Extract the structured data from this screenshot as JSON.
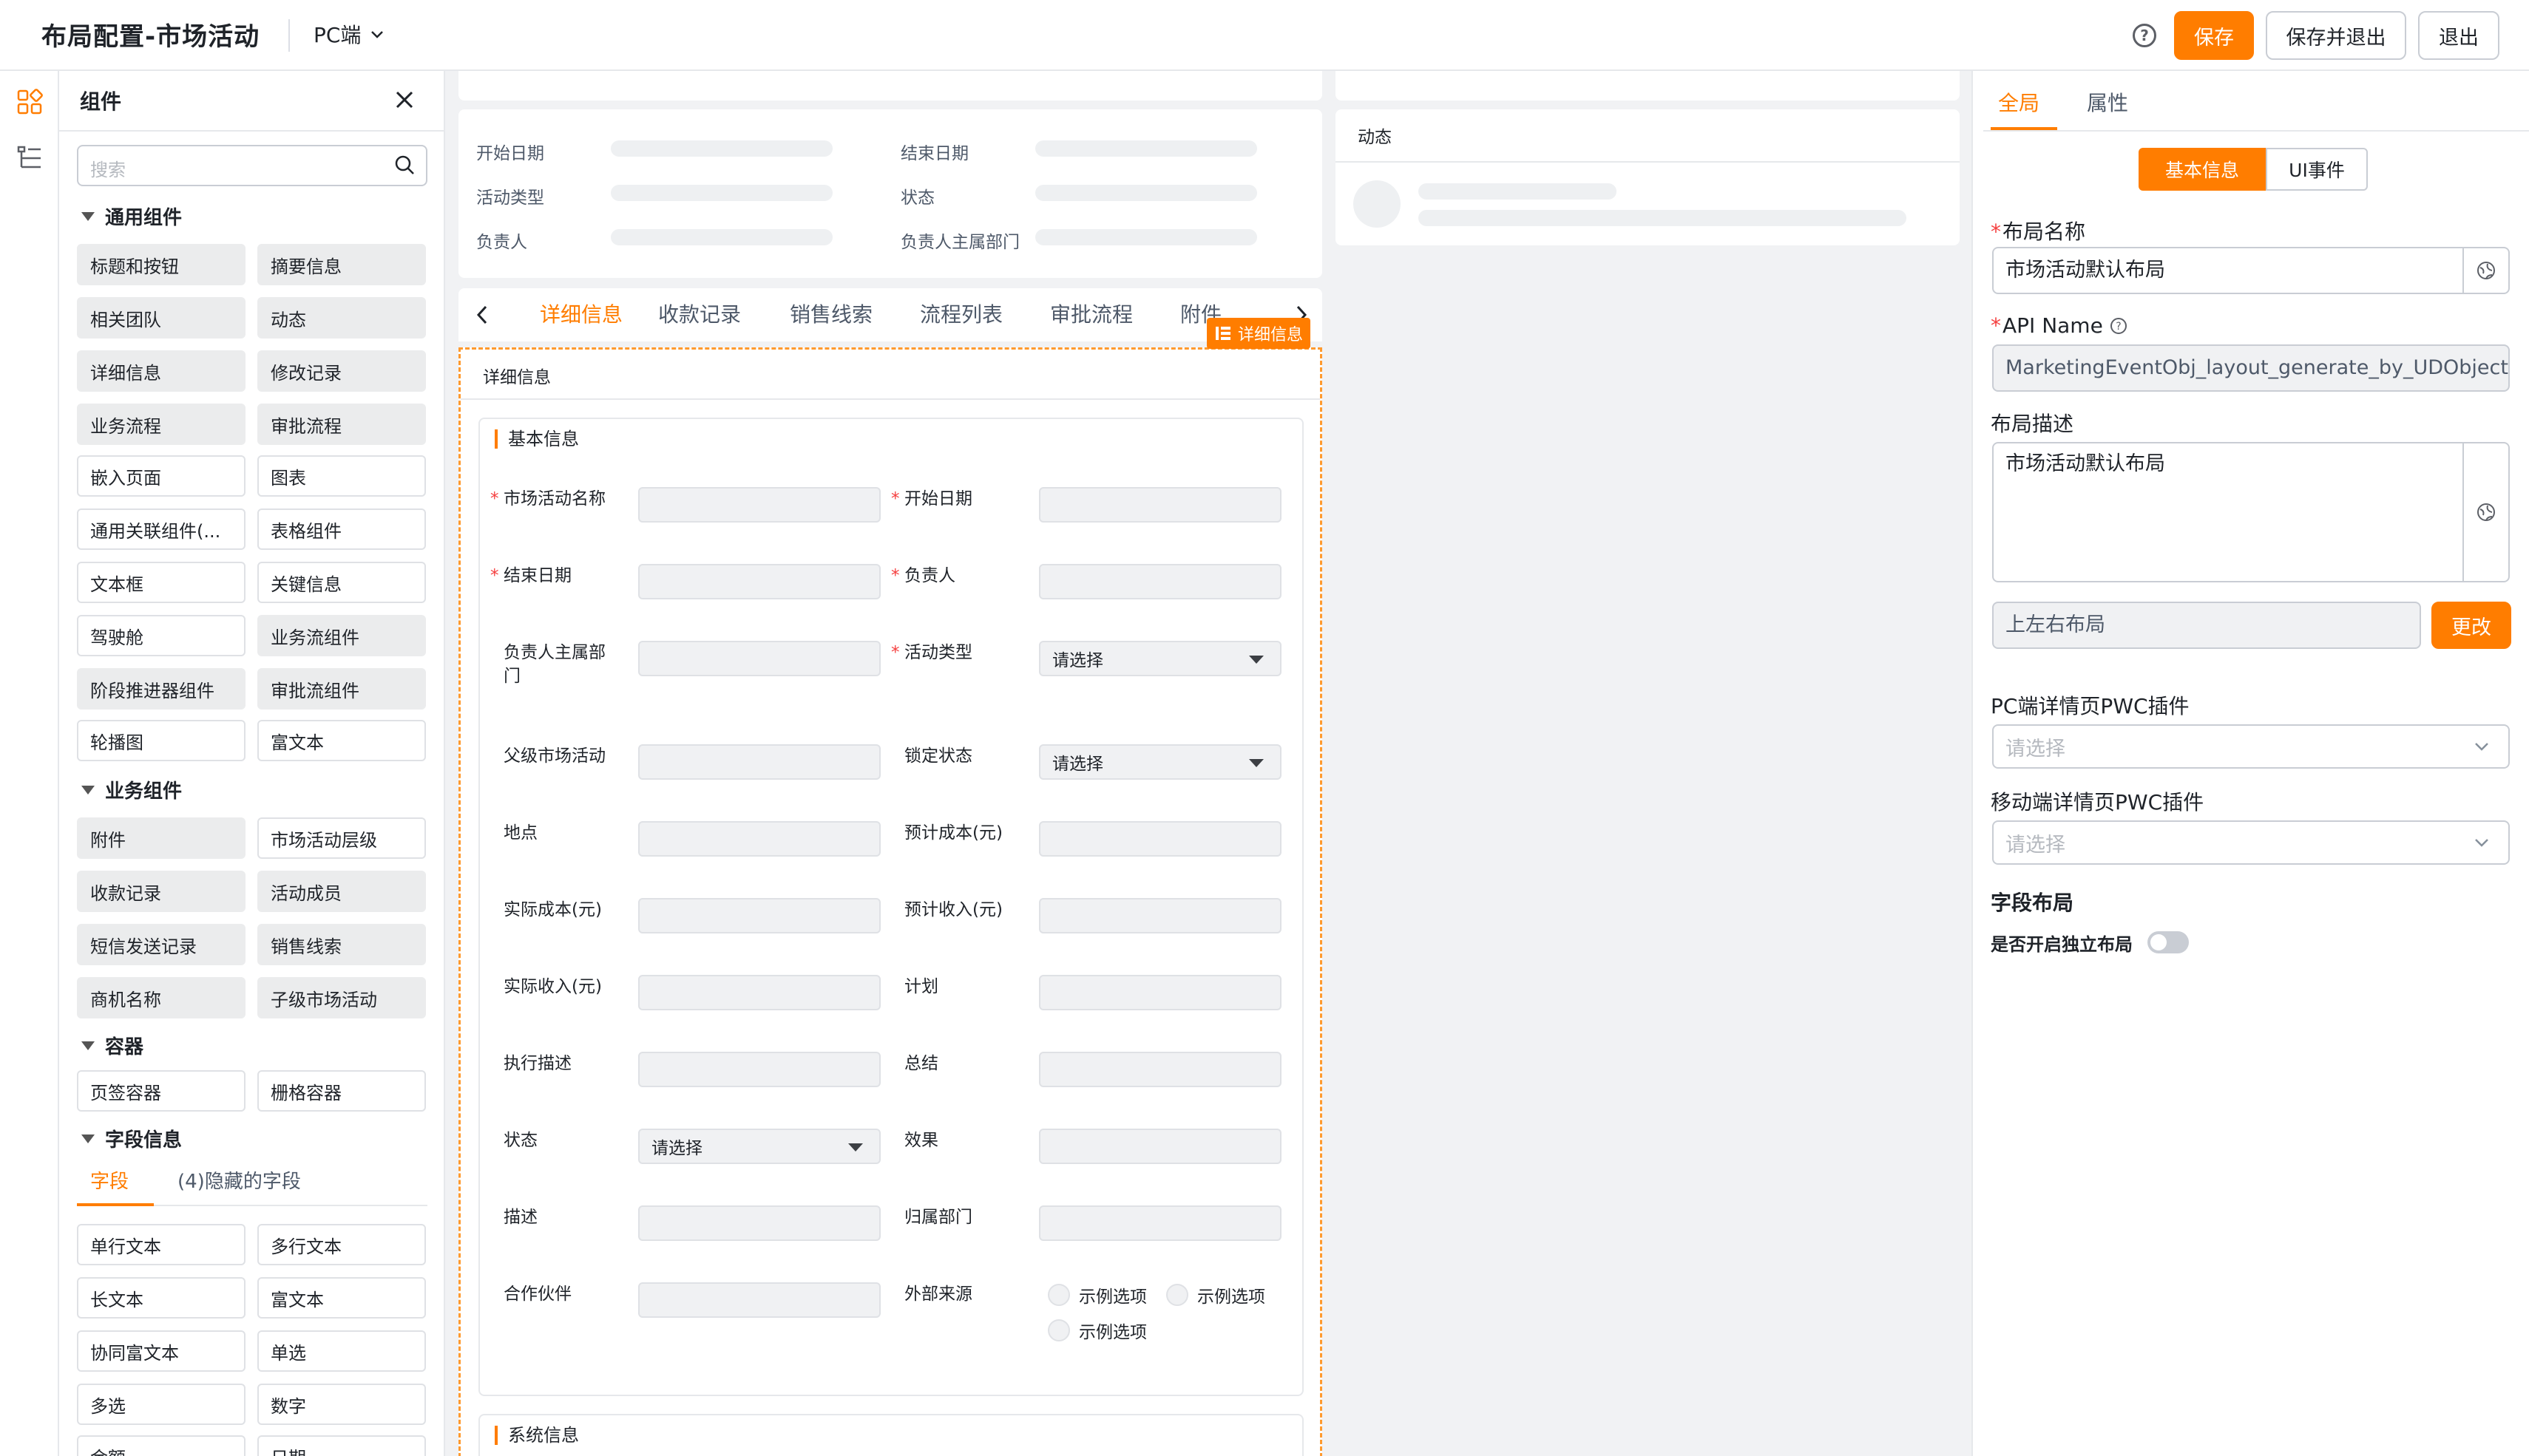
{
  "header": {
    "title": "布局配置-市场活动",
    "platform": "PC端",
    "help": "?",
    "save": "保存",
    "save_exit": "保存并退出",
    "exit": "退出"
  },
  "components": {
    "title": "组件",
    "search_placeholder": "搜索",
    "groups": [
      {
        "name": "通用组件",
        "items": [
          "标题和按钮",
          "摘要信息",
          "相关团队",
          "动态",
          "详细信息",
          "修改记录",
          "业务流程",
          "审批流程",
          "嵌入页面",
          "图表",
          "通用关联组件(...",
          "表格组件",
          "文本框",
          "关键信息",
          "驾驶舱",
          "业务流组件",
          "阶段推进器组件",
          "审批流组件",
          "轮播图",
          "富文本"
        ]
      },
      {
        "name": "业务组件",
        "items": [
          "附件",
          "市场活动层级",
          "收款记录",
          "活动成员",
          "短信发送记录",
          "销售线索",
          "商机名称",
          "子级市场活动"
        ]
      },
      {
        "name": "容器",
        "items": [
          "页签容器",
          "栅格容器"
        ]
      },
      {
        "name": "字段信息",
        "items": [
          "单行文本",
          "多行文本",
          "长文本",
          "富文本",
          "协同富文本",
          "单选",
          "多选",
          "数字",
          "金额",
          "日期"
        ]
      }
    ],
    "field_tabs": [
      "字段",
      "(4)隐藏的字段"
    ]
  },
  "canvas": {
    "summary_fields": [
      "开始日期",
      "结束日期",
      "活动类型",
      "状态",
      "负责人",
      "负责人主属部门"
    ],
    "feed_title": "动态",
    "tabs": [
      "详细信息",
      "收款记录",
      "销售线索",
      "流程列表",
      "审批流程",
      "附件"
    ],
    "selected_tag": "详细信息",
    "detail_title": "详细信息",
    "basic_section": "基本信息",
    "system_section": "系统信息",
    "placeholder_select": "请选择",
    "fields": [
      {
        "label": "市场活动名称",
        "required": "*"
      },
      {
        "label": "开始日期",
        "required": "*"
      },
      {
        "label": "结束日期",
        "required": "*"
      },
      {
        "label": "负责人",
        "required": "*"
      },
      {
        "label": "负责人主属部门",
        "required": ""
      },
      {
        "label": "活动类型",
        "required": "*"
      },
      {
        "label": "父级市场活动",
        "required": ""
      },
      {
        "label": "锁定状态",
        "required": ""
      },
      {
        "label": "地点",
        "required": ""
      },
      {
        "label": "预计成本(元)",
        "required": ""
      },
      {
        "label": "实际成本(元)",
        "required": ""
      },
      {
        "label": "预计收入(元)",
        "required": ""
      },
      {
        "label": "实际收入(元)",
        "required": ""
      },
      {
        "label": "计划",
        "required": ""
      },
      {
        "label": "执行描述",
        "required": ""
      },
      {
        "label": "总结",
        "required": ""
      },
      {
        "label": "状态",
        "required": ""
      },
      {
        "label": "效果",
        "required": ""
      },
      {
        "label": "描述",
        "required": ""
      },
      {
        "label": "归属部门",
        "required": ""
      },
      {
        "label": "合作伙伴",
        "required": ""
      },
      {
        "label": "外部来源",
        "required": ""
      }
    ],
    "radio_options": [
      "示例选项",
      "示例选项",
      "示例选项"
    ]
  },
  "properties": {
    "tabs": [
      "全局",
      "属性"
    ],
    "segments": [
      "基本信息",
      "UI事件"
    ],
    "layout_name_label": "布局名称",
    "layout_name_value": "市场活动默认布局",
    "api_label": "API Name",
    "api_value": "MarketingEventObj_layout_generate_by_UDObjectServer",
    "desc_label": "布局描述",
    "desc_value": "市场活动默认布局",
    "layout_type": "上左右布局",
    "change_btn": "更改",
    "pc_plugin_label": "PC端详情页PWC插件",
    "pc_plugin_placeholder": "请选择",
    "mobile_plugin_label": "移动端详情页PWC插件",
    "mobile_plugin_placeholder": "请选择",
    "field_layout_title": "字段布局",
    "independent_label": "是否开启独立布局",
    "required_mark": "*",
    "accent_color": "#ff7d00"
  }
}
